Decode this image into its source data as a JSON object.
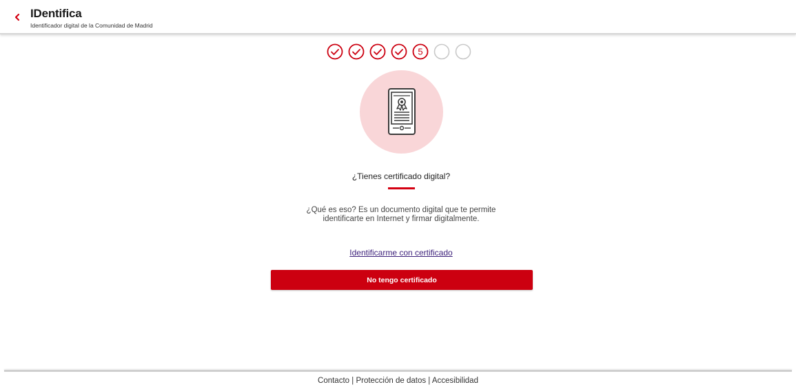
{
  "header": {
    "title": "IDentifica",
    "subtitle": "Identificador digital de la Comunidad de Madrid"
  },
  "stepper": {
    "current_step_label": "5",
    "completed_steps": 4,
    "total_steps": 7
  },
  "main": {
    "question": "¿Tienes certificado digital?",
    "description_line1": "¿Qué es eso? Es un documento digital que te permite",
    "description_line2": "identificarte en Internet y firmar digitalmente.",
    "certificate_link": "Identificarme con certificado",
    "no_certificate_button": "No tengo certificado",
    "illustration_icon": "certificate-tablet-icon"
  },
  "footer": {
    "contact": "Contacto",
    "separator": "|",
    "data_protection": "Protección de datos",
    "accessibility": "Accesibilidad"
  },
  "colors": {
    "brand_red": "#cc0010",
    "accent_pink": "#f9d6d8",
    "pending_gray": "#c8c8c8",
    "link_purple": "#3b1f7a"
  }
}
